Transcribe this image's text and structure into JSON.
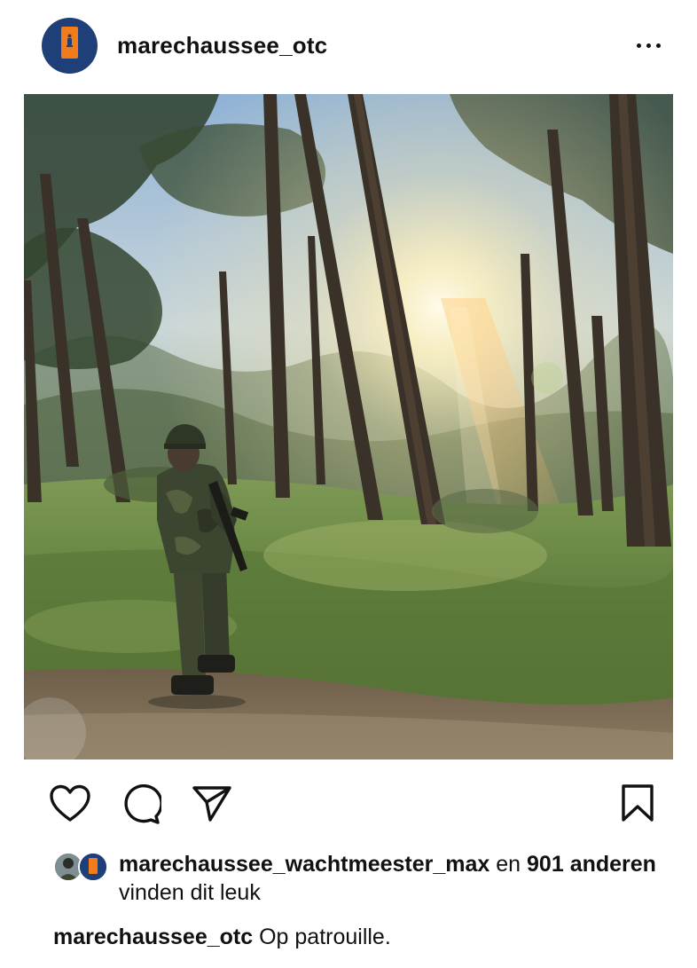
{
  "post": {
    "author": "marechaussee_otc",
    "more_icon": "more-horizontal-icon",
    "image_alt": "Soldier in camouflage standing in a sunlit pine forest",
    "actions": {
      "like_icon": "heart-icon",
      "comment_icon": "comment-bubble-icon",
      "share_icon": "paper-plane-icon",
      "save_icon": "bookmark-icon"
    },
    "likes": {
      "liker_username": "marechaussee_wachtmeester_max",
      "connector": " en ",
      "others_count": "901",
      "others_word": "anderen",
      "suffix": " vinden dit leuk"
    },
    "caption": {
      "username": "marechaussee_otc",
      "text": " Op patrouille."
    }
  },
  "colors": {
    "avatar_blue": "#1f3f78",
    "avatar_orange": "#f07c1c",
    "text": "#111111"
  }
}
